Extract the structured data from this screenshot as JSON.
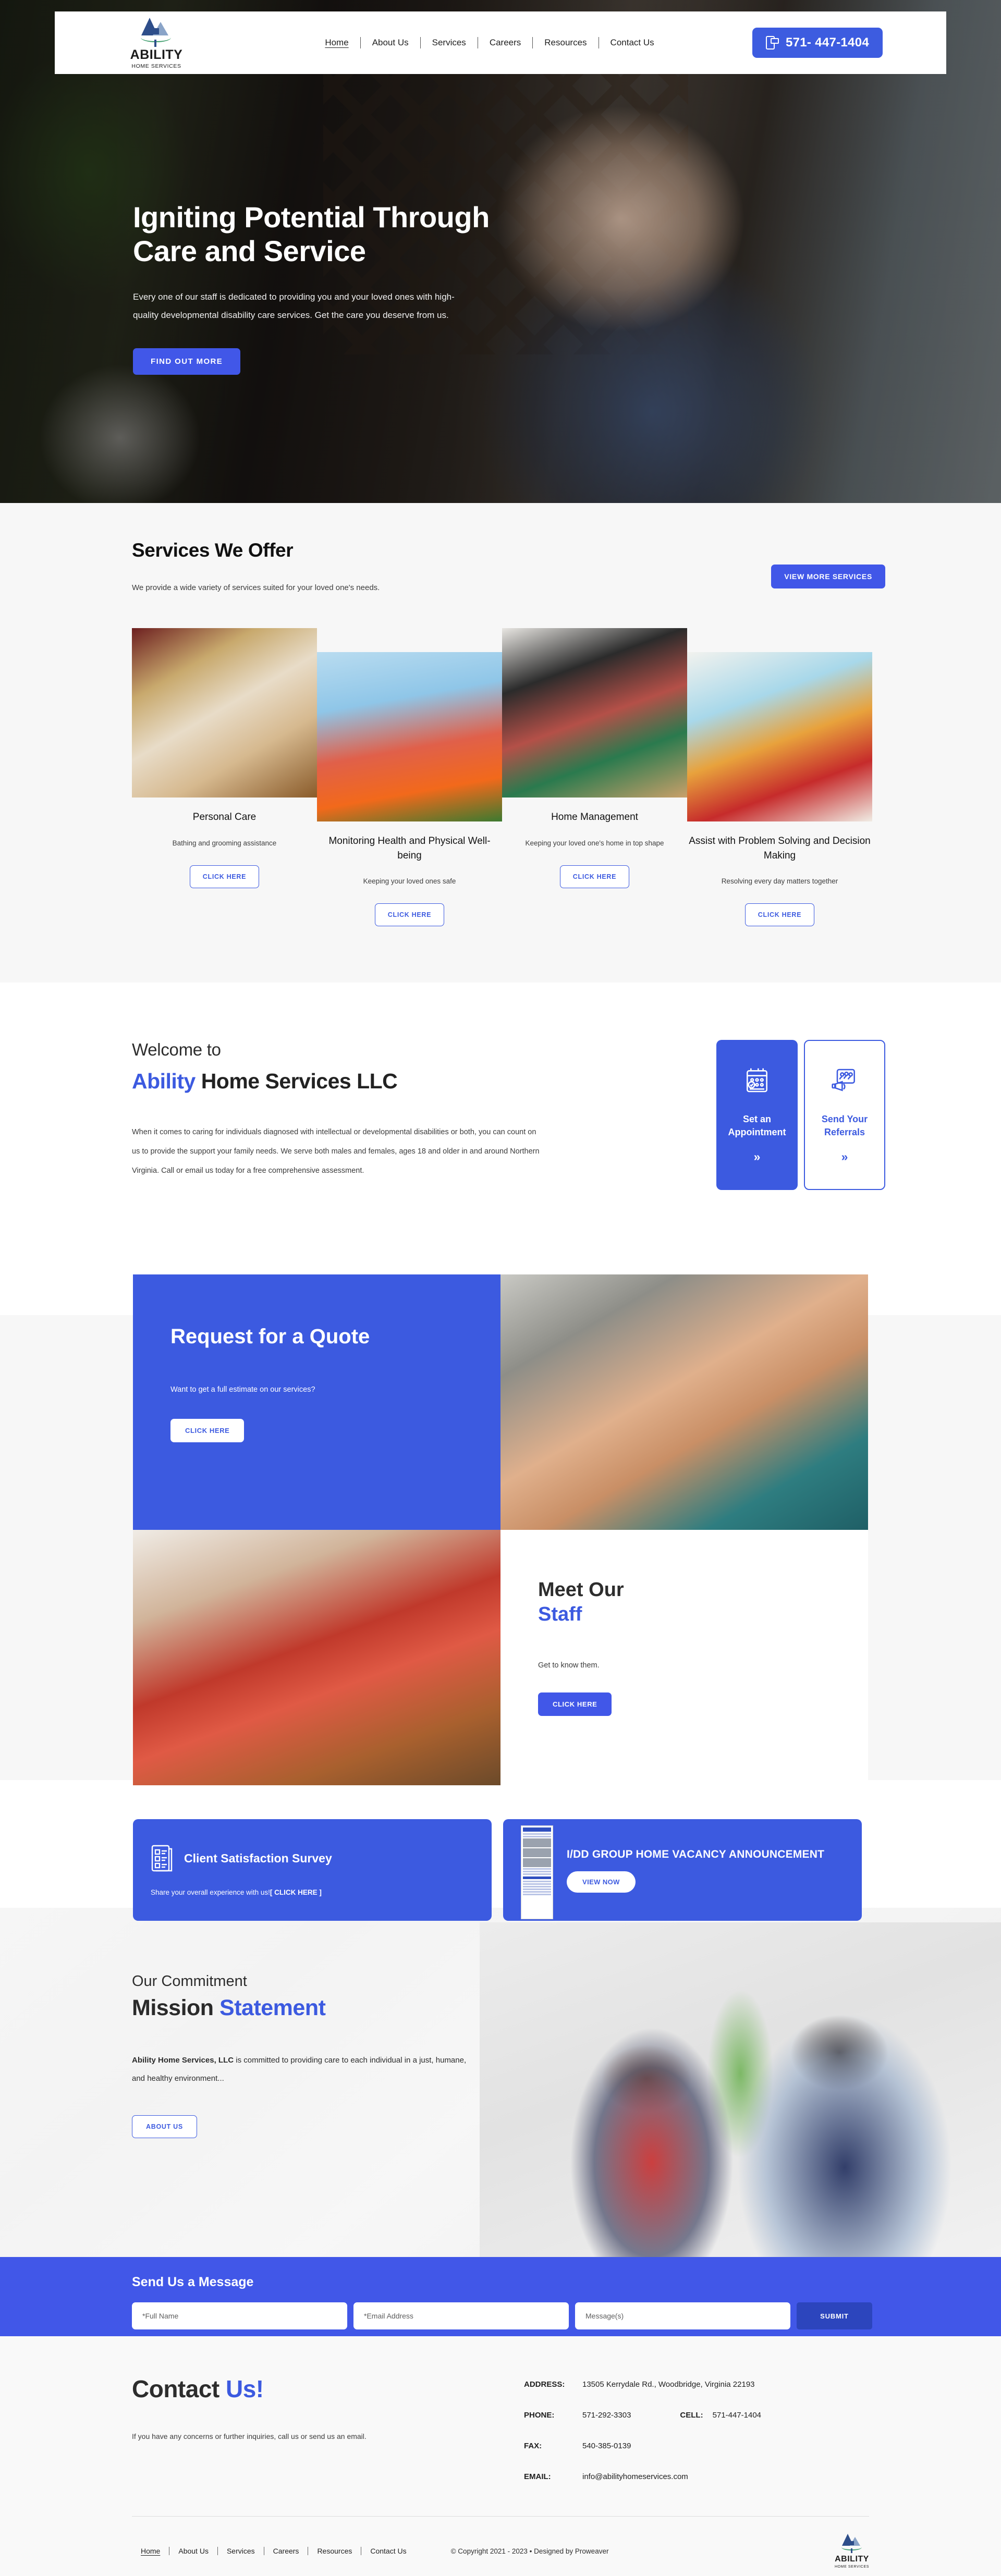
{
  "brand": {
    "name": "ABILITY",
    "tagline": "HOME SERVICES",
    "accent_color": "#3c5ae0",
    "logo_icon": "house-caduceus-logo"
  },
  "header": {
    "nav": [
      {
        "label": "Home",
        "active": true
      },
      {
        "label": "About Us",
        "active": false
      },
      {
        "label": "Services",
        "active": false
      },
      {
        "label": "Careers",
        "active": false
      },
      {
        "label": "Resources",
        "active": false
      },
      {
        "label": "Contact Us",
        "active": false
      }
    ],
    "phone_button": "571- 447-1404",
    "phone_icon": "phone-chat-icon"
  },
  "hero": {
    "heading": "Igniting Potential Through Care and Service",
    "paragraph": "Every one of our staff is dedicated to providing you and your loved ones with high-quality developmental disability care services. Get the care you deserve from us.",
    "cta": "FIND OUT MORE"
  },
  "services": {
    "title": "Services We Offer",
    "subtitle": "We provide a wide variety of services suited for your loved one's needs.",
    "view_more": "VIEW MORE SERVICES",
    "cards": [
      {
        "title": "Personal Care",
        "desc": "Bathing and grooming assistance",
        "cta": "CLICK HERE"
      },
      {
        "title": "Monitoring Health and Physical Well-being",
        "desc": "Keeping your loved ones safe",
        "cta": "CLICK HERE"
      },
      {
        "title": "Home Management",
        "desc": "Keeping your loved one's home in top shape",
        "cta": "CLICK HERE"
      },
      {
        "title": "Assist with Problem Solving and Decision Making",
        "desc": "Resolving every day matters together",
        "cta": "CLICK HERE"
      }
    ]
  },
  "welcome": {
    "kicker": "Welcome to",
    "title_accent": "Ability",
    "title_rest": " Home Services LLC",
    "body": "When it comes to caring for individuals diagnosed with intellectual or developmental disabilities or both, you can count on us to provide the support your family needs. We serve both males and females, ages 18 and older in and around Northern Virginia. Call or email us today for a free comprehensive assessment.",
    "cards": [
      {
        "label": "Set an Appointment",
        "chevron": "»",
        "icon": "calendar-clipboard-icon"
      },
      {
        "label": "Send Your Referrals",
        "chevron": "»",
        "icon": "referral-megaphone-icon"
      }
    ]
  },
  "quote": {
    "title": "Request for a Quote",
    "subtitle": "Want to get a full estimate on our services?",
    "cta": "CLICK HERE"
  },
  "staff": {
    "title_top": "Meet Our",
    "title_accent": "Staff",
    "subtitle": "Get to know them.",
    "cta": "CLICK HERE"
  },
  "promos": {
    "survey": {
      "title": "Client Satisfaction Survey",
      "note_plain": "Share your overall experience with us!",
      "note_link": "[ CLICK HERE ]",
      "icon": "survey-clipboard-icon"
    },
    "vacancy": {
      "title": "I/DD GROUP HOME VACANCY ANNOUNCEMENT",
      "cta": "VIEW NOW",
      "icon": "flyer-thumbnail"
    }
  },
  "mission": {
    "kicker": "Our Commitment",
    "title_dark": "Mission ",
    "title_accent": "Statement",
    "body_bold": "Ability Home Services, LLC",
    "body_rest": " is committed to providing care to each individual in a just, humane, and healthy environment...",
    "cta": "ABOUT US"
  },
  "message": {
    "title": "Send Us a Message",
    "fields": {
      "name_placeholder": "*Full Name",
      "name_value": "",
      "email_placeholder": "*Email Address",
      "email_value": "",
      "message_placeholder": "Message(s)",
      "message_value": ""
    },
    "submit": "SUBMIT"
  },
  "contact": {
    "title_dark": "Contact ",
    "title_accent": "Us!",
    "note": "If you have any concerns or further inquiries, call us or send us an email.",
    "rows": {
      "address_label": "ADDRESS:",
      "address_value": "13505 Kerrydale Rd., Woodbridge, Virginia 22193",
      "phone_label": "PHONE:",
      "phone_value": "571-292-3303",
      "cell_label": "CELL:",
      "cell_value": "571-447-1404",
      "fax_label": "FAX:",
      "fax_value": "540-385-0139",
      "email_label": "EMAIL:",
      "email_value": "info@abilityhomeservices.com"
    }
  },
  "footer": {
    "nav": [
      {
        "label": "Home",
        "active": true
      },
      {
        "label": "About Us",
        "active": false
      },
      {
        "label": "Services",
        "active": false
      },
      {
        "label": "Careers",
        "active": false
      },
      {
        "label": "Resources",
        "active": false
      },
      {
        "label": "Contact Us",
        "active": false
      }
    ],
    "copyright": "© Copyright 2021 - 2023  •  Designed by Proweaver"
  }
}
